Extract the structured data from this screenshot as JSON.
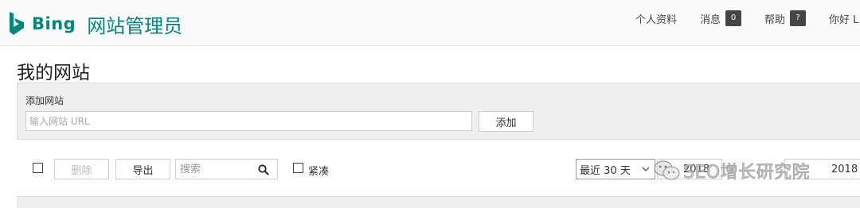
{
  "header": {
    "brand": "Bing",
    "product": "网站管理员",
    "nav": {
      "profile": "个人资料",
      "messages": "消息",
      "messages_count": "0",
      "help": "帮助",
      "help_badge": "?",
      "greeting": "你好 L"
    }
  },
  "page_title": "我的网站",
  "add_site": {
    "label": "添加网站",
    "placeholder": "输入网站 URL",
    "button": "添加"
  },
  "toolbar": {
    "delete": "删除",
    "export": "导出",
    "search_placeholder": "搜索",
    "compact": "紧凑",
    "range": "最近 30 天",
    "date_from": "2018",
    "date_to": "2018"
  },
  "watermark": {
    "text": "SEO增长研究院"
  },
  "colors": {
    "brand": "#00897b",
    "badge": "#454545",
    "panel": "#efefef"
  }
}
